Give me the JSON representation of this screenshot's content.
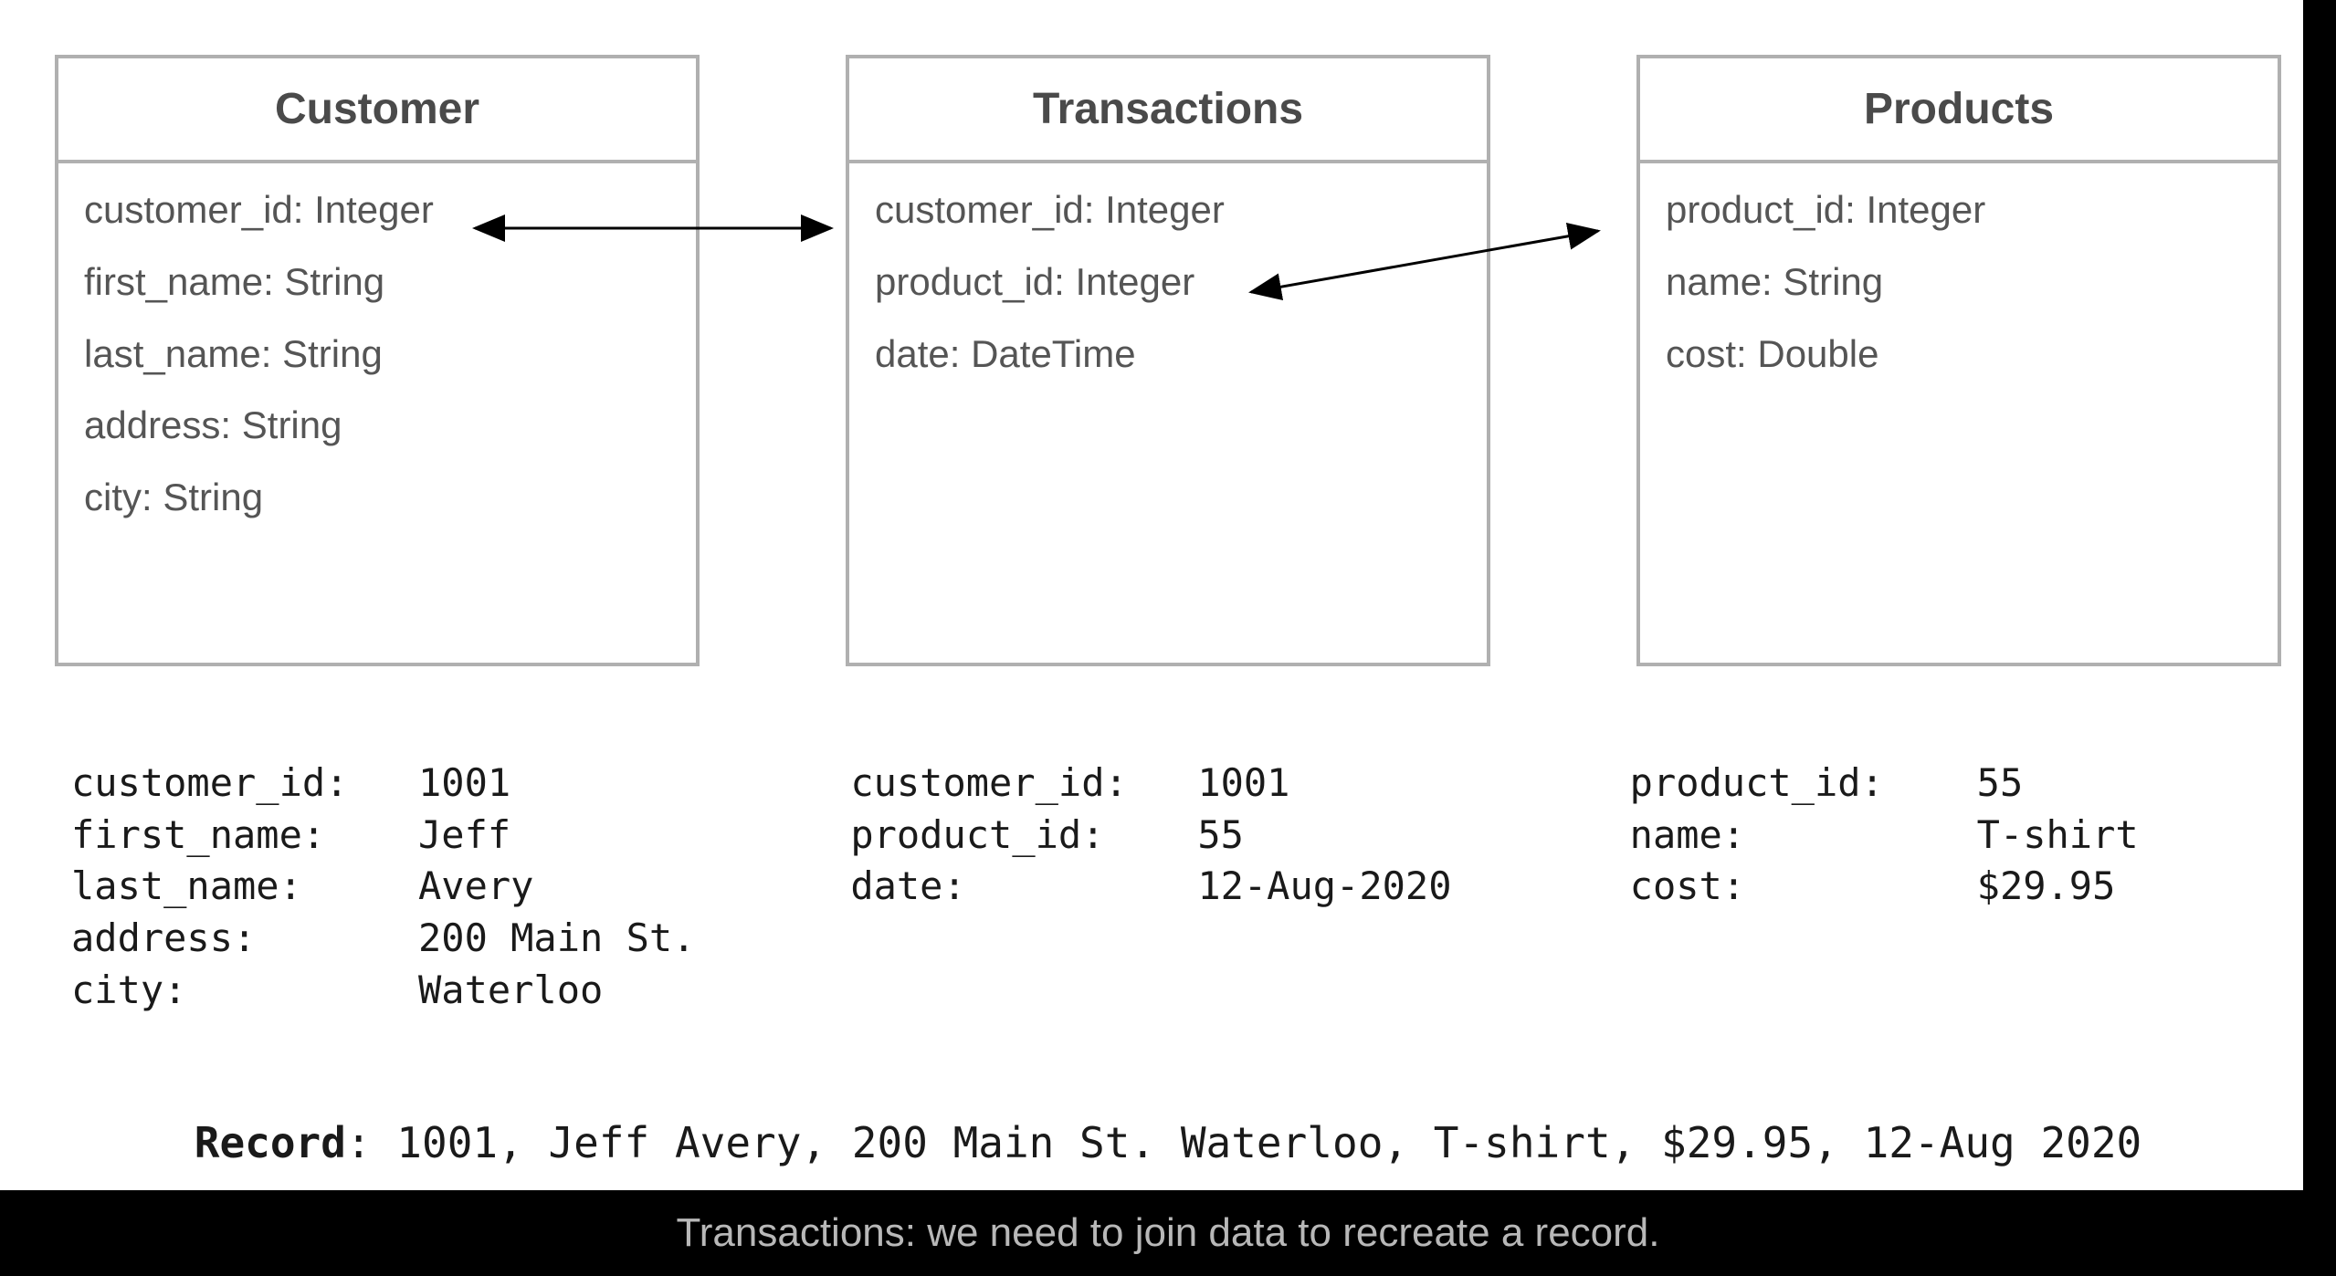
{
  "tables": [
    {
      "title": "Customer",
      "fields": [
        "customer_id: Integer",
        "first_name: String",
        "last_name: String",
        "address: String",
        "city: String"
      ]
    },
    {
      "title": "Transactions",
      "fields": [
        "customer_id: Integer",
        "product_id: Integer",
        "date: DateTime"
      ]
    },
    {
      "title": "Products",
      "fields": [
        "product_id: Integer",
        "name: String",
        "cost: Double"
      ]
    }
  ],
  "examples": [
    {
      "rows": [
        {
          "key": "customer_id:",
          "value": "1001"
        },
        {
          "key": "first_name:",
          "value": "Jeff"
        },
        {
          "key": "last_name:",
          "value": "Avery"
        },
        {
          "key": "address:",
          "value": "200 Main St."
        },
        {
          "key": "city:",
          "value": "Waterloo"
        }
      ]
    },
    {
      "rows": [
        {
          "key": "customer_id:",
          "value": "1001"
        },
        {
          "key": "product_id:",
          "value": "55"
        },
        {
          "key": "date:",
          "value": "12-Aug-2020"
        }
      ]
    },
    {
      "rows": [
        {
          "key": "product_id:",
          "value": "55"
        },
        {
          "key": "name:",
          "value": "T-shirt"
        },
        {
          "key": "cost:",
          "value": "$29.95"
        }
      ]
    }
  ],
  "record": {
    "label": "Record",
    "value": ": 1001, Jeff Avery, 200 Main St. Waterloo, T-shirt, $29.95, 12-Aug 2020"
  },
  "caption": "Transactions: we need to join data to recreate a record."
}
